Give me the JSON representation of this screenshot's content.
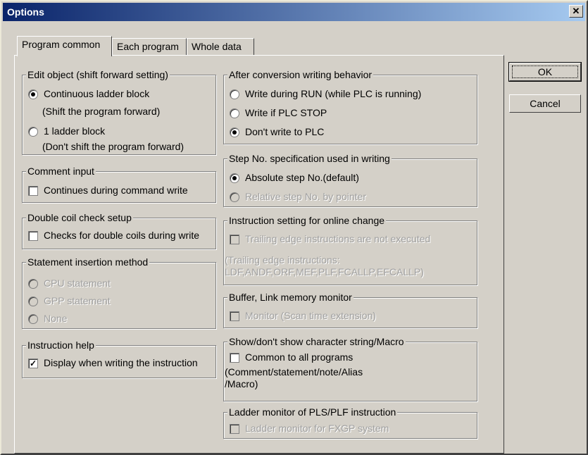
{
  "window": {
    "title": "Options",
    "close_glyph": "✕"
  },
  "tabs": [
    {
      "label": "Program common",
      "active": true
    },
    {
      "label": "Each program",
      "active": false
    },
    {
      "label": "Whole data",
      "active": false
    }
  ],
  "buttons": {
    "ok": "OK",
    "cancel": "Cancel"
  },
  "left": {
    "edit_object": {
      "title": "Edit object (shift forward setting)",
      "continuous": "Continuous ladder block",
      "continuous_note": "(Shift the program forward)",
      "one_block": "1 ladder block",
      "one_block_note": "(Don't shift the program forward)"
    },
    "comment_input": {
      "title": "Comment input",
      "option": "Continues during command write"
    },
    "double_coil": {
      "title": "Double coil check setup",
      "option": "Checks for double coils during write"
    },
    "statement_insertion": {
      "title": "Statement insertion method",
      "cpu": "CPU statement",
      "gpp": "GPP statement",
      "none": "None"
    },
    "instruction_help": {
      "title": "Instruction help",
      "option": "Display when writing the instruction"
    }
  },
  "right": {
    "after_conversion": {
      "title": "After conversion writing behavior",
      "run": "Write during RUN (while PLC is running)",
      "stop": "Write if PLC STOP",
      "dont": "Don't write to PLC"
    },
    "step_no": {
      "title": "Step No. specification used in writing",
      "absolute": "Absolute step No.(default)",
      "relative": "Relative step No. by pointer"
    },
    "online_change": {
      "title": "Instruction setting for online change",
      "option": "Trailing edge instructions are not executed",
      "note1": "(Trailing edge instructions:",
      "note2": "LDF,ANDF,ORF,MEF,PLF,FCALLP,EFCALLP)"
    },
    "buffer_monitor": {
      "title": "Buffer, Link memory monitor",
      "option": "Monitor (Scan time extension)"
    },
    "show_string": {
      "title": "Show/don't show character string/Macro",
      "option": "Common to all programs",
      "note1": "(Comment/statement/note/Alias",
      "note2": "/Macro)"
    },
    "ladder_monitor": {
      "title": "Ladder monitor of PLS/PLF instruction",
      "option": "Ladder monitor for FXGP system"
    }
  }
}
